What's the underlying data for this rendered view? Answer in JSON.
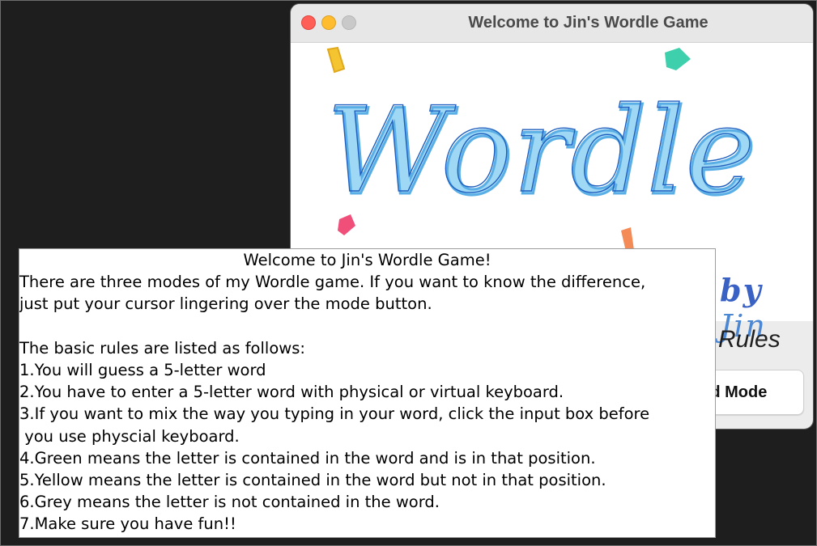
{
  "window": {
    "title": "Welcome to Jin's Wordle Game",
    "logo": {
      "wordmark": "Wordle",
      "byline_prefix": "by",
      "byline_name": "Jin"
    },
    "rules_label": "Rules",
    "mode_button_label": "Hard Mode",
    "traffic_lights": [
      "close",
      "minimize",
      "zoom"
    ]
  },
  "popup": {
    "heading": "Welcome to Jin's Wordle Game!",
    "lines": [
      "There are three modes of my Wordle game. If you want to know the difference,",
      "just put your cursor lingering over the mode button.",
      "",
      "The basic rules are listed as follows:",
      "1.You will guess a 5-letter word",
      "2.You have to enter a 5-letter word with physical or virtual keyboard.",
      "3.If you want to mix the way you typing in your word, click the input box before",
      " you use physcial keyboard.",
      "4.Green means the letter is contained in the word and is in that position.",
      "5.Yellow means the letter is contained in the word but not in that position.",
      "6.Grey means the letter is not contained in the word.",
      "7.Make sure you have fun!!"
    ]
  },
  "colors": {
    "close": "#ff5f57",
    "minimize": "#febc2e",
    "zoom": "#c9c9c9",
    "wordmark_light": "#7ec8ef",
    "wordmark_dark": "#1f5fbf",
    "confetti": [
      "#f2c230",
      "#36c9a4",
      "#ef3f6b",
      "#f58a4b"
    ]
  }
}
